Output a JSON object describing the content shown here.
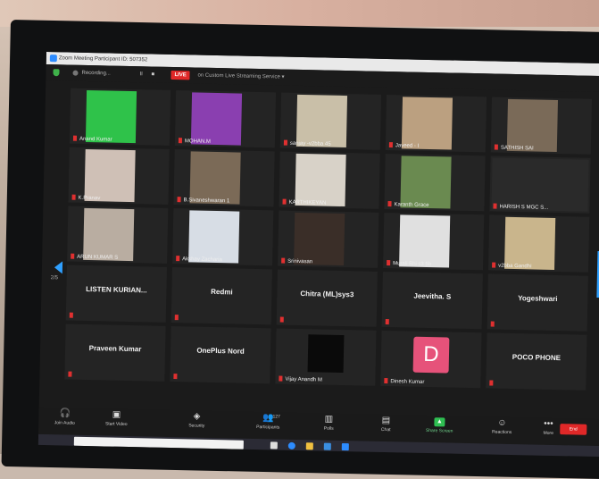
{
  "window": {
    "title": "Zoom Meeting Participant ID: 507352"
  },
  "top": {
    "recording": "Recording...",
    "pause": "II",
    "stop": "■",
    "live": "LIVE",
    "live_service": "on Custom Live Streaming Service ▾"
  },
  "tiles": [
    {
      "name": "Anand Kumar",
      "color": "#2fc24a",
      "kind": "video"
    },
    {
      "name": "MOHAN.M",
      "color": "#8a3fb0",
      "kind": "video"
    },
    {
      "name": "sanjay -v2bba 45",
      "color": "#c9bfa8",
      "kind": "video"
    },
    {
      "name": "Javeed - I",
      "color": "#bba080",
      "kind": "video"
    },
    {
      "name": "SATHISH SAI",
      "color": "#7a6a58",
      "kind": "video"
    },
    {
      "name": "K.Pranav",
      "color": "#cfc0b6",
      "kind": "video"
    },
    {
      "name": "B.Sivaneshwaran 1",
      "color": "#7b6a57",
      "kind": "video"
    },
    {
      "name": "KARTHIKEYAN",
      "color": "#d8d2c8",
      "kind": "video"
    },
    {
      "name": "Karanth Grace",
      "color": "#6a8a50",
      "kind": "video"
    },
    {
      "name": "HARISH S MGC S...",
      "color": "#2a2a2a",
      "kind": "dark"
    },
    {
      "name": "ARUN KUMAR S",
      "color": "#b9ada1",
      "kind": "video"
    },
    {
      "name": "Akshay Zacharia",
      "color": "#d7dde5",
      "kind": "video"
    },
    {
      "name": "Srinivasan",
      "color": "#3a2e28",
      "kind": "video"
    },
    {
      "name": "Murali Bhi s3 5b",
      "color": "#e0e0e0",
      "kind": "video"
    },
    {
      "name": "v2bba Gandhi",
      "color": "#c9b58c",
      "kind": "video"
    },
    {
      "name": "LISTEN KURIAN...",
      "kind": "name"
    },
    {
      "name": "Redmi",
      "kind": "name"
    },
    {
      "name": "Chitra (ML)sys3",
      "kind": "name"
    },
    {
      "name": "Jeevitha. S",
      "kind": "name"
    },
    {
      "name": "Yogeshwari",
      "kind": "name"
    },
    {
      "name": "Praveen Kumar",
      "kind": "name"
    },
    {
      "name": "OnePlus Nord",
      "kind": "name"
    },
    {
      "name": "Vijay Anandh M",
      "kind": "black"
    },
    {
      "name": "Dinesh Kumar",
      "kind": "avatar",
      "letter": "D"
    },
    {
      "name": "POCO PHONE",
      "kind": "name"
    }
  ],
  "pager": {
    "page": "2/5"
  },
  "toolbar": {
    "items": [
      {
        "label": "Join Audio",
        "icon": "headphones-icon",
        "glyph": "🎧"
      },
      {
        "label": "Start Video",
        "icon": "camera-off-icon",
        "glyph": "▣"
      },
      {
        "label": "Security",
        "icon": "shield-icon",
        "glyph": "◈"
      },
      {
        "label": "Participants",
        "icon": "participants-icon",
        "glyph": "👥",
        "count": "127"
      },
      {
        "label": "Polls",
        "icon": "polls-icon",
        "glyph": "▥"
      },
      {
        "label": "Chat",
        "icon": "chat-icon",
        "glyph": "▤"
      },
      {
        "label": "Share Screen",
        "icon": "share-screen-icon",
        "glyph": "▲"
      },
      {
        "label": "Reactions",
        "icon": "reactions-icon",
        "glyph": "☺"
      },
      {
        "label": "More",
        "icon": "more-icon",
        "glyph": "•••"
      }
    ],
    "end": "End"
  },
  "colors": {
    "accent": "#2fa0ff",
    "live": "#e02828",
    "share": "#2fbf52",
    "avatar": "#e6527a"
  }
}
